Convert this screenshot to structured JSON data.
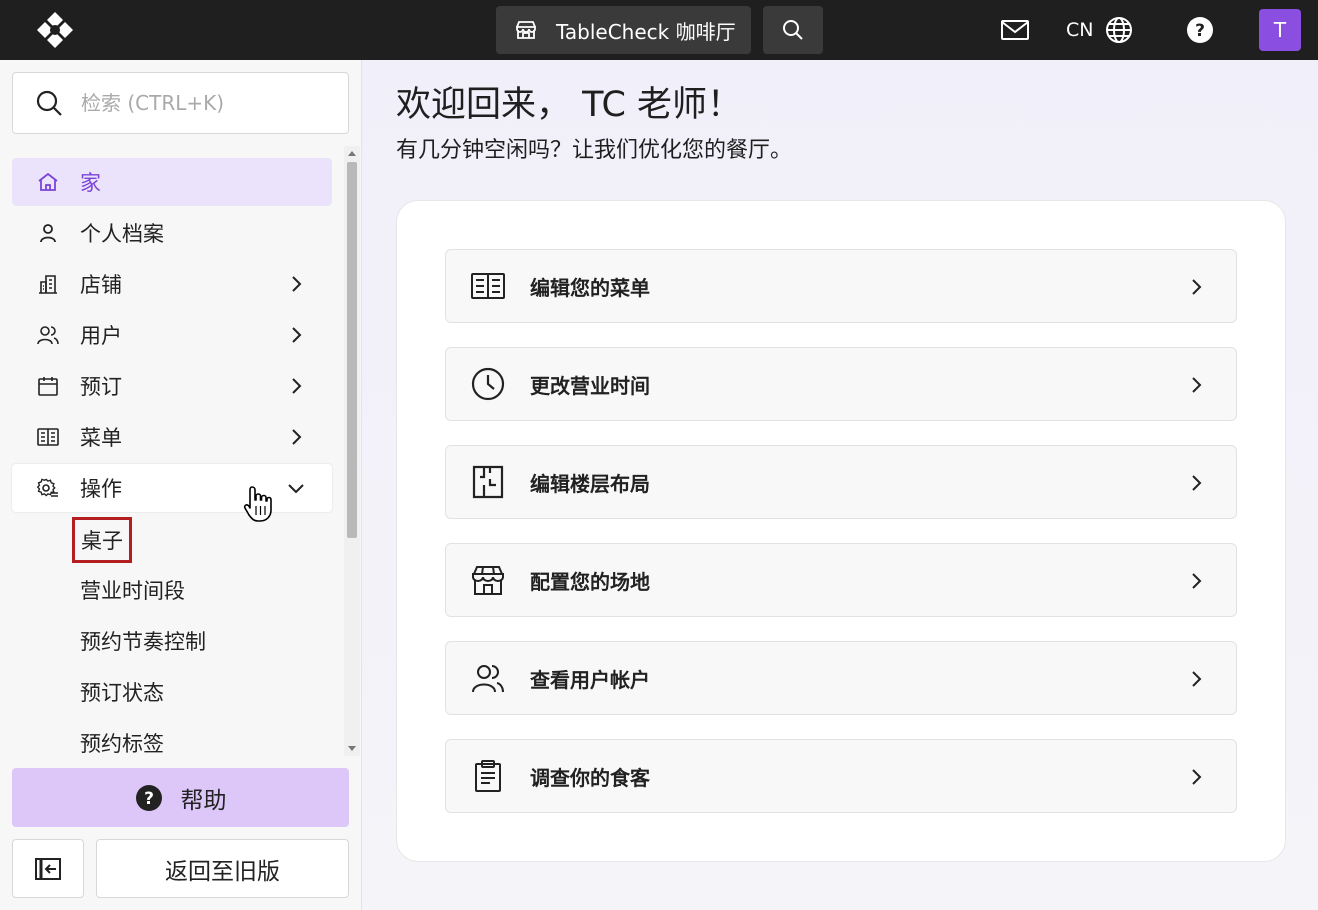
{
  "topbar": {
    "venue_name": "TableCheck 咖啡厅",
    "language": "CN",
    "avatar_letter": "T"
  },
  "sidebar": {
    "search_placeholder": "检索 (CTRL+K)",
    "items": [
      {
        "label": "家",
        "icon": "home-icon",
        "active": true
      },
      {
        "label": "个人档案",
        "icon": "person-icon"
      },
      {
        "label": "店铺",
        "icon": "building-icon",
        "expandable": true
      },
      {
        "label": "用户",
        "icon": "users-icon",
        "expandable": true
      },
      {
        "label": "预订",
        "icon": "calendar-icon",
        "expandable": true
      },
      {
        "label": "菜单",
        "icon": "menu-book-icon",
        "expandable": true
      },
      {
        "label": "操作",
        "icon": "gear-cog-icon",
        "expandable": true,
        "expanded": true
      }
    ],
    "sub_items": [
      "桌子",
      "营业时间段",
      "预约节奏控制",
      "预订状态",
      "预约标签"
    ],
    "help_label": "帮助",
    "legacy_label": "返回至旧版"
  },
  "main": {
    "welcome": "欢迎回来， TC 老师！",
    "subtitle": "有几分钟空闲吗？让我们优化您的餐厅。",
    "actions": [
      {
        "label": "编辑您的菜单",
        "icon": "menu-book-icon"
      },
      {
        "label": "更改营业时间",
        "icon": "clock-icon"
      },
      {
        "label": "编辑楼层布局",
        "icon": "floor-plan-icon"
      },
      {
        "label": "配置您的场地",
        "icon": "storefront-icon"
      },
      {
        "label": "查看用户帐户",
        "icon": "users-icon"
      },
      {
        "label": "调查你的食客",
        "icon": "clipboard-icon"
      }
    ]
  },
  "colors": {
    "accent": "#7b43d6",
    "active_bg": "#ebe3fb",
    "help_bg": "#dcc7f8",
    "avatar_bg": "#8a4fe0",
    "selected_outline": "#b41e1e",
    "topbar_bg": "#1f1f1f"
  }
}
